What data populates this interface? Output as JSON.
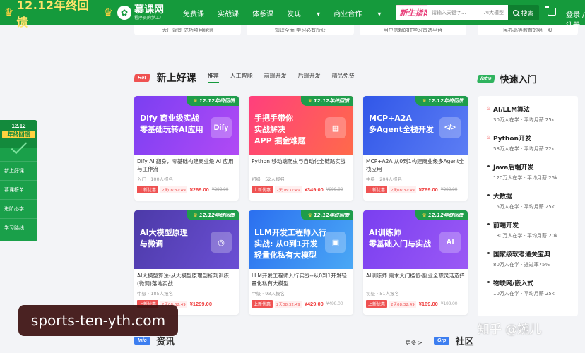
{
  "header": {
    "promo_text": "12.12年终回馈",
    "logo_name": "慕课网",
    "logo_slogan": "程序员的梦工厂",
    "nav": [
      "免费课",
      "实战课",
      "体系课",
      "发现",
      "商业合作"
    ],
    "guide_badge": "新生指南",
    "search_placeholder": "请输入关键字...",
    "search_hint": "AI大模型",
    "search_button": "搜索",
    "login": "登录 / 注册"
  },
  "prev_row": [
    "大厂背景 成功项目经验",
    "知识全面 学习必有所获",
    "用户信赖的IT学习首选平台",
    "民办高等教育的第一股"
  ],
  "section": {
    "hot_badge": "Hot",
    "title": "新上好课",
    "tabs": [
      "推荐",
      "人工智能",
      "前端开发",
      "后端开发",
      "精品免费"
    ]
  },
  "left_float": {
    "year": "12.12",
    "badge": "年终回馈",
    "items": [
      "新上好课",
      "慕课榜单",
      "进阶必学",
      "学习路线"
    ]
  },
  "courses": [
    {
      "cover_title": "Dify 商业级实战\n零基础玩转AI应用",
      "icon": "Dify",
      "ribbon": "12.12年终回馈",
      "desc": "Dify AI 翻身，零基础构建商业级 AI 应用与工作流",
      "meta": "入门 · 100人报名",
      "badge": "上新优惠",
      "timer": "2天08:32:49",
      "price": "¥269.00",
      "old_price": "¥299.00",
      "color_a": "#7b3ff2",
      "color_b": "#b14af5"
    },
    {
      "cover_title": "手把手带你\n实战解决\nAPP 掘金难题",
      "icon": "▦",
      "ribbon": "12.12年终回馈",
      "desc": "Python 移动端爬虫与自动化全链路实战",
      "meta": "初级 · 52人报名",
      "badge": "上新优惠",
      "timer": "2天08:32:49",
      "price": "¥349.00",
      "old_price": "¥399.00",
      "color_a": "#ff3f7d",
      "color_b": "#ff6a4a"
    },
    {
      "cover_title": "MCP+A2A\n多Agent全栈开发",
      "icon": "</>",
      "ribbon": "12.12年终回馈",
      "desc": "MCP+A2A 从0到1构建商业级多Agent全栈应用",
      "meta": "中级 · 204人报名",
      "badge": "上新优惠",
      "timer": "2天08:32:49",
      "price": "¥769.00",
      "old_price": "¥900.00",
      "color_a": "#3157e8",
      "color_b": "#5c7df4"
    },
    {
      "cover_title": "AI大模型原理\n与微调",
      "icon": "◎",
      "ribbon": "12.12年终回馈",
      "desc": "AI大模型算法-从大模型原理剖析到训练(微调)落地实战",
      "meta": "中级 · 185人报名",
      "badge": "上新优惠",
      "timer": "2天08:32:49",
      "price": "¥1299.00",
      "old_price": "",
      "color_a": "#4c3aa8",
      "color_b": "#6b4fd4"
    },
    {
      "cover_title": "LLM开发工程师入行\n实战: 从0到1开发\n轻量化私有大模型",
      "icon": "▣",
      "ribbon": "12.12年终回馈",
      "desc": "LLM开发工程师入行实战--从0到1开发轻量化私有大模型",
      "meta": "中级 · 93人报名",
      "badge": "上新优惠",
      "timer": "2天08:32:49",
      "price": "¥429.00",
      "old_price": "¥499.00",
      "color_a": "#2b6ff0",
      "color_b": "#4aa8f5"
    },
    {
      "cover_title": "AI训练师\n零基础入门与实战",
      "icon": "AI",
      "ribbon": "12.12年终回馈",
      "desc": "AI训练师 需求大门槛低-副业全职灵活选择",
      "meta": "初级 · 51人报名",
      "badge": "上新优惠",
      "timer": "2天08:32:49",
      "price": "¥169.00",
      "old_price": "¥199.00",
      "color_a": "#7a3ff0",
      "color_b": "#9b59f5"
    }
  ],
  "quick_start": {
    "badge": "Intro",
    "title": "快速入门",
    "items": [
      {
        "title": "AI/LLM算法",
        "sub": "30万人在学 · 平均月薪 25k",
        "hot": true
      },
      {
        "title": "Python开发",
        "sub": "58万人在学 · 平均月薪 22k",
        "hot": true
      },
      {
        "title": "Java后端开发",
        "sub": "120万人在学 · 平均月薪 25k",
        "hot": false
      },
      {
        "title": "大数据",
        "sub": "15万人在学 · 平均月薪 25k",
        "hot": false
      },
      {
        "title": "前端开发",
        "sub": "180万人在学 · 平均月薪 20k",
        "hot": false
      },
      {
        "title": "国家级软考通关宝典",
        "sub": "80万人在学 · 通过率75%",
        "hot": false
      },
      {
        "title": "物联网/嵌入式",
        "sub": "10万人在学 · 平均月薪 25k",
        "hot": false
      }
    ]
  },
  "bottom": {
    "info_badge": "Info",
    "info_title": "资讯",
    "more": "更多 >",
    "grp_badge": "Grp",
    "grp_title": "社区"
  },
  "overlays": {
    "url": "sports-ten-yth.com",
    "watermark": "知乎 @婉儿"
  }
}
